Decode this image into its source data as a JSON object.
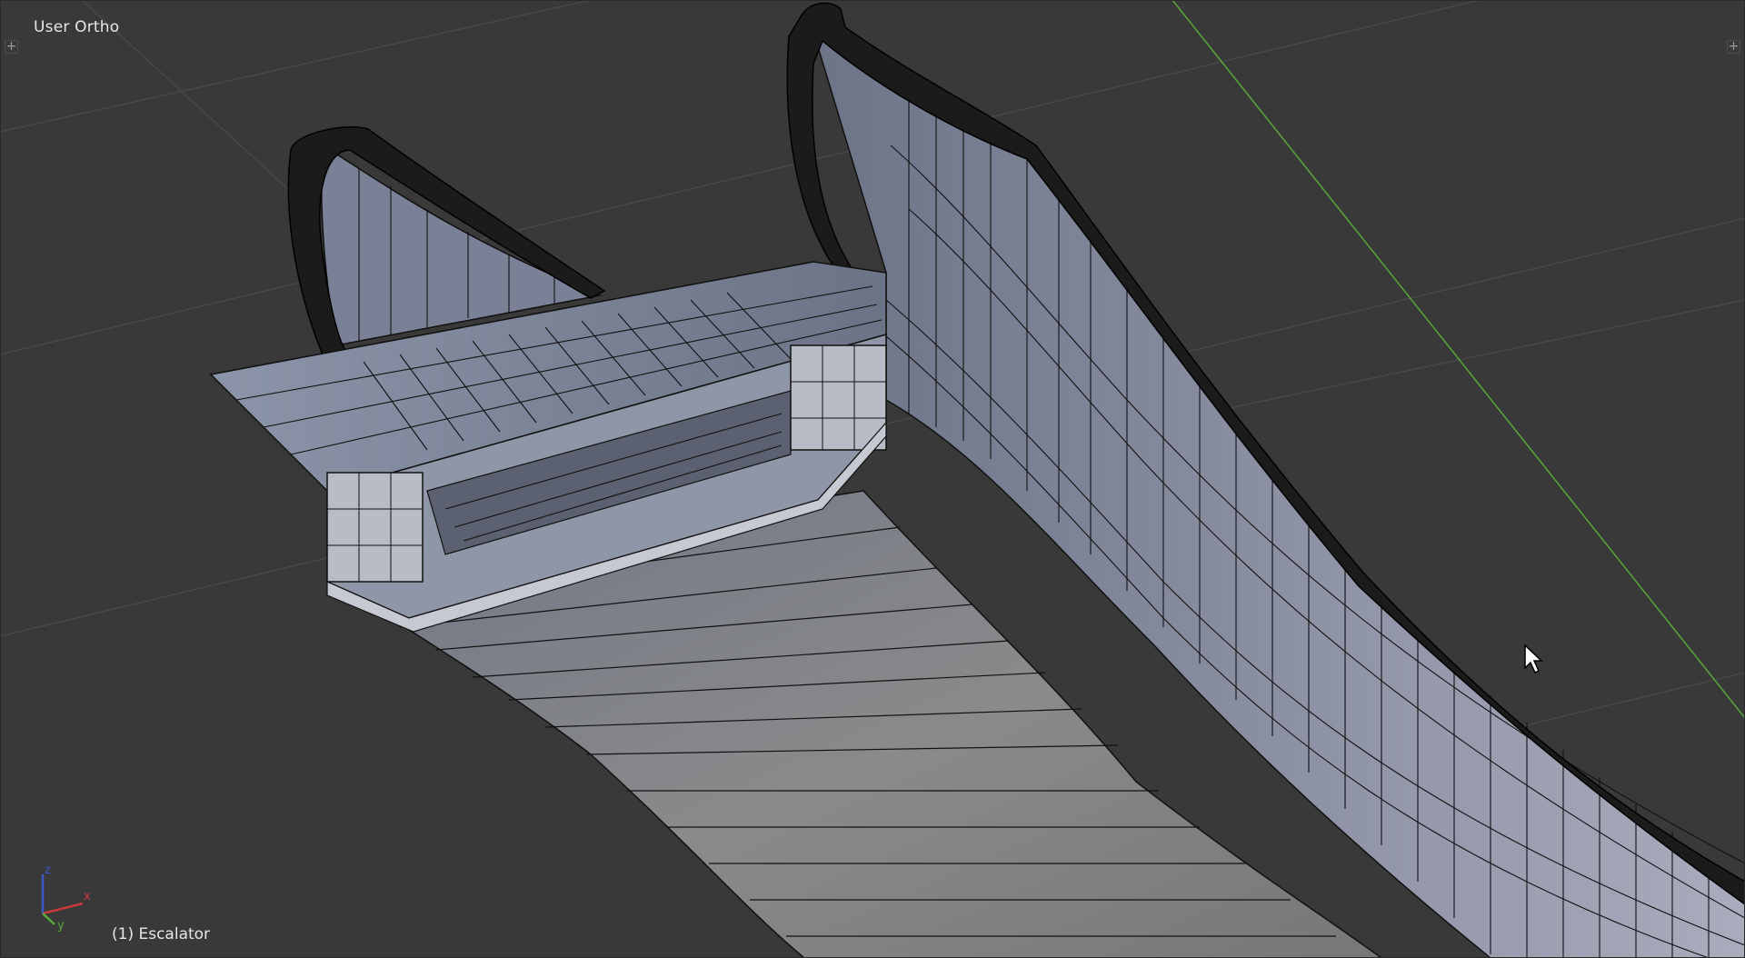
{
  "viewport": {
    "view_label": "User Ortho",
    "object_label": "(1) Escalator",
    "gizmo": {
      "z": "z",
      "y": "y",
      "x": "x"
    },
    "colors": {
      "background": "#393939",
      "grid": "#484848",
      "y_axis": "#58a83a",
      "x_axis": "#c83a3a",
      "z_axis": "#3a5ac8",
      "mesh_face": "#7b8394",
      "mesh_edge": "#000000",
      "rail": "#1a1a1a"
    },
    "icons": {
      "corner_left": "plus-icon",
      "corner_right": "plus-icon",
      "cursor": "mouse-pointer-icon"
    }
  }
}
